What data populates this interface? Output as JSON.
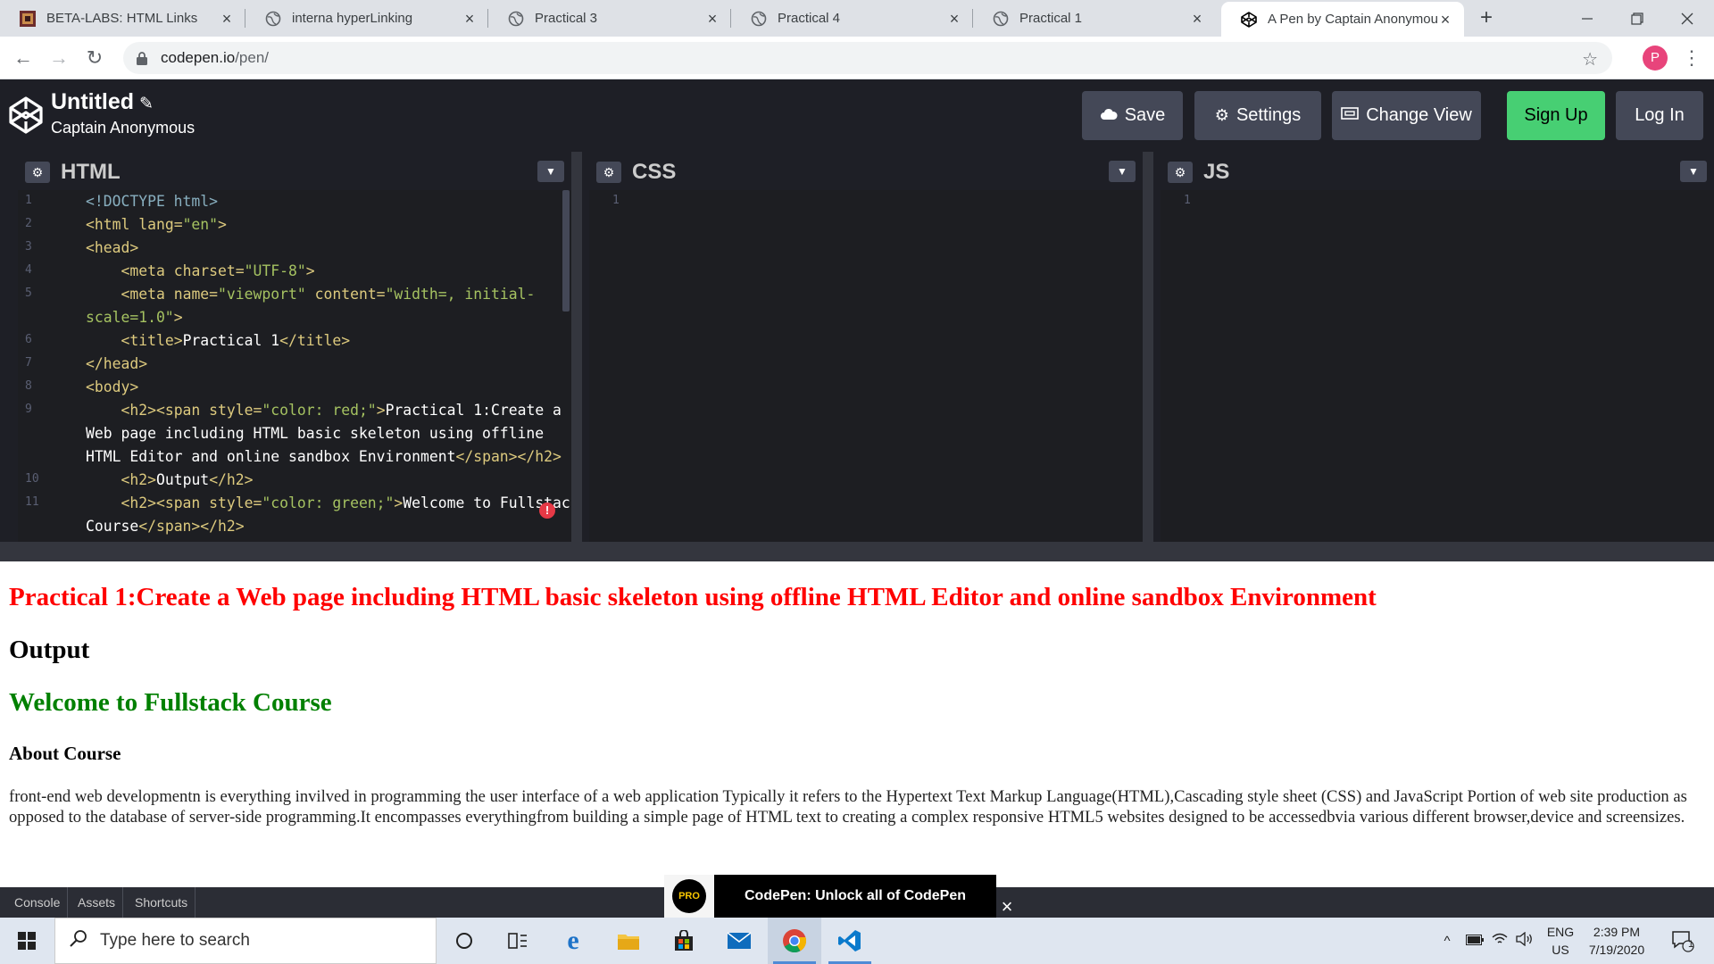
{
  "browser": {
    "tabs": [
      {
        "label": "BETA-LABS: HTML Links",
        "active": false
      },
      {
        "label": "interna hyperLinking",
        "active": false
      },
      {
        "label": "Practical 3",
        "active": false
      },
      {
        "label": "Practical 4",
        "active": false
      },
      {
        "label": "Practical 1",
        "active": false
      },
      {
        "label": "A Pen by Captain Anonymou",
        "active": true
      }
    ],
    "url_host": "codepen.io",
    "url_path": "/pen/",
    "profile_initial": "P"
  },
  "codepen": {
    "title": "Untitled",
    "author": "Captain Anonymous",
    "buttons": {
      "save": "Save",
      "settings": "Settings",
      "change_view": "Change View",
      "sign_up": "Sign Up",
      "log_in": "Log In"
    },
    "editors": {
      "html": "HTML",
      "css": "CSS",
      "js": "JS"
    },
    "html_line_numbers": [
      "1",
      "2",
      "3",
      "4",
      "5",
      "6",
      "7",
      "8",
      "9",
      "10",
      "11"
    ],
    "css_line_number": "1",
    "js_line_number": "1",
    "bottom_buttons": [
      "Console",
      "Assets",
      "Shortcuts"
    ],
    "promo_badge": "PRO",
    "promo_text": "CodePen: Unlock all of CodePen"
  },
  "output": {
    "heading1": "Practical 1:Create a Web page including HTML basic skeleton using offline HTML Editor and online sandbox Environment",
    "heading2": "Output",
    "heading3": "Welcome to Fullstack Course",
    "subheading": "About Course",
    "paragraph": "front-end web developmentn is everything invilved in programming the user interface of a web application Typically it refers to the Hypertext Text Markup Language(HTML),Cascading style sheet (CSS) and JavaScript Portion of web site production as opposed to the database of server-side programming.It encompasses everythingfrom building a simple page of HTML text to creating a complex responsive HTML5 websites designed to be accessedbvia various different browser,device and screensizes."
  },
  "taskbar": {
    "search_placeholder": "Type here to search",
    "lang_top": "ENG",
    "lang_bottom": "US",
    "time": "2:39 PM",
    "date": "7/19/2020",
    "notification_count": "1"
  },
  "colors": {
    "codepen_bg": "#1e1f26",
    "signup_green": "#47cf73",
    "output_red": "#ff0000",
    "output_green": "#008000"
  }
}
